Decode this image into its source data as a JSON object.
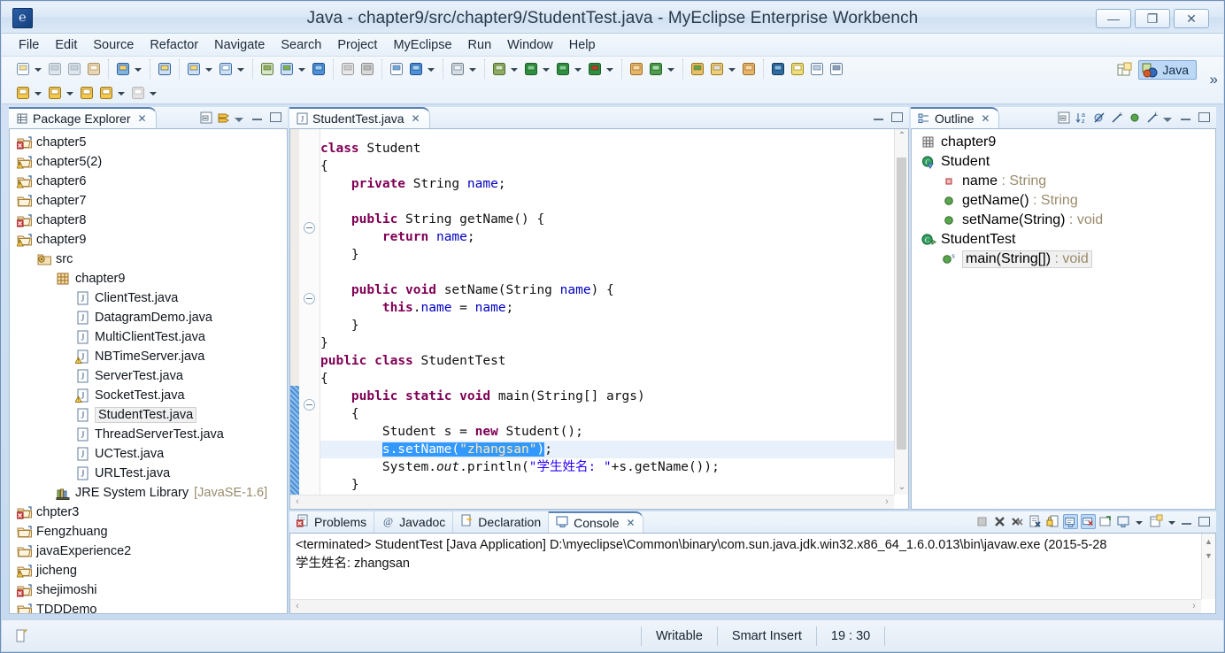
{
  "window": {
    "title": "Java - chapter9/src/chapter9/StudentTest.java - MyEclipse Enterprise Workbench",
    "app_icon": "eclipse-icon",
    "minimize_label": "—",
    "restore_label": "❐",
    "close_label": "✕"
  },
  "menubar": {
    "items": [
      "File",
      "Edit",
      "Source",
      "Refactor",
      "Navigate",
      "Search",
      "Project",
      "MyEclipse",
      "Run",
      "Window",
      "Help"
    ]
  },
  "toolbar": {
    "perspective_label": "Java",
    "overflow_label": "»",
    "groups_row1": [
      [
        "new-wizard-icon",
        "new-dropdown-arrow",
        "save-icon",
        "save-all-icon",
        "print-icon"
      ],
      [
        "myeclipse-icon",
        "myeclipse-dropdown-arrow"
      ],
      [
        "deploy-icon"
      ],
      [
        "new-java-project-icon",
        "new-java-dd-arrow",
        "new-class-icon",
        "new-class-dd-arrow"
      ],
      [
        "import-icon",
        "export-icon",
        "export-dd-arrow",
        "web-browser-icon"
      ],
      [
        "build-icon",
        "refresh-icon"
      ],
      [
        "report-icon",
        "web-preview-icon",
        "web-preview-dd-arrow"
      ],
      [
        "database-icon",
        "database-dd-arrow"
      ],
      [
        "debug-icon",
        "debug-dd-arrow",
        "run-icon",
        "run-dd-arrow",
        "run-config-icon",
        "run-config-dd-arrow",
        "coverage-icon",
        "coverage-dd-arrow"
      ],
      [
        "new-package-icon",
        "open-type-icon",
        "open-type-dd-arrow"
      ],
      [
        "open-folder-icon",
        "edit-icon",
        "edit-dd-arrow",
        "package-icon"
      ],
      [
        "search-icon",
        "highlight-icon",
        "outline-toggle-icon",
        "pilcrow-icon"
      ]
    ],
    "groups_row2": [
      [
        "previous-annotation-icon",
        "prev-annotation-dd-arrow",
        "next-annotation-icon",
        "next-annotation-dd-arrow",
        "back-icon",
        "forward-icon",
        "forward-dd-arrow",
        "next-edit-icon",
        "next-edit-dd-arrow"
      ]
    ]
  },
  "package_explorer": {
    "title": "Package Explorer",
    "close_label": "✕",
    "tools": [
      "collapse-all-icon",
      "link-with-editor-icon",
      "view-menu-icon",
      "minimize-icon",
      "maximize-icon"
    ],
    "tree": [
      {
        "label": "chapter5",
        "indent": 0,
        "icon": "project-closed-error-icon",
        "twisty": ""
      },
      {
        "label": "chapter5(2)",
        "indent": 0,
        "icon": "project-closed-warn-icon",
        "twisty": ""
      },
      {
        "label": "chapter6",
        "indent": 0,
        "icon": "project-closed-warn-icon",
        "twisty": ""
      },
      {
        "label": "chapter7",
        "indent": 0,
        "icon": "project-closed-icon",
        "twisty": ""
      },
      {
        "label": "chapter8",
        "indent": 0,
        "icon": "project-closed-error-icon",
        "twisty": ""
      },
      {
        "label": "chapter9",
        "indent": 0,
        "icon": "project-open-warn-icon",
        "twisty": ""
      },
      {
        "label": "src",
        "indent": 1,
        "icon": "source-folder-icon",
        "twisty": ""
      },
      {
        "label": "chapter9",
        "indent": 2,
        "icon": "package-icon",
        "twisty": ""
      },
      {
        "label": "ClientTest.java",
        "indent": 3,
        "icon": "java-file-icon",
        "twisty": ""
      },
      {
        "label": "DatagramDemo.java",
        "indent": 3,
        "icon": "java-file-icon",
        "twisty": ""
      },
      {
        "label": "MultiClientTest.java",
        "indent": 3,
        "icon": "java-file-icon",
        "twisty": ""
      },
      {
        "label": "NBTimeServer.java",
        "indent": 3,
        "icon": "java-file-warn-icon",
        "twisty": ""
      },
      {
        "label": "ServerTest.java",
        "indent": 3,
        "icon": "java-file-icon",
        "twisty": ""
      },
      {
        "label": "SocketTest.java",
        "indent": 3,
        "icon": "java-file-warn-icon",
        "twisty": ""
      },
      {
        "label": "StudentTest.java",
        "indent": 3,
        "icon": "java-file-icon",
        "selected": true,
        "twisty": ""
      },
      {
        "label": "ThreadServerTest.java",
        "indent": 3,
        "icon": "java-file-icon",
        "twisty": ""
      },
      {
        "label": "UCTest.java",
        "indent": 3,
        "icon": "java-file-icon",
        "twisty": ""
      },
      {
        "label": "URLTest.java",
        "indent": 3,
        "icon": "java-file-icon",
        "twisty": ""
      },
      {
        "label": "JRE System Library",
        "indent": 2,
        "icon": "library-icon",
        "suffix": "[JavaSE-1.6]",
        "twisty": ""
      },
      {
        "label": "chpter3",
        "indent": 0,
        "icon": "project-closed-error-icon",
        "twisty": ""
      },
      {
        "label": "Fengzhuang",
        "indent": 0,
        "icon": "project-closed-icon",
        "twisty": ""
      },
      {
        "label": "javaExperience2",
        "indent": 0,
        "icon": "project-closed-icon",
        "twisty": ""
      },
      {
        "label": "jicheng",
        "indent": 0,
        "icon": "project-closed-warn-icon",
        "twisty": ""
      },
      {
        "label": "shejimoshi",
        "indent": 0,
        "icon": "project-closed-error-icon",
        "twisty": ""
      },
      {
        "label": "TDDDemo",
        "indent": 0,
        "icon": "project-closed-icon",
        "twisty": ""
      }
    ]
  },
  "editor": {
    "tab_label": "StudentTest.java",
    "tab_icon": "java-file-icon",
    "close_label": "✕",
    "tools": [
      "minimize-icon",
      "maximize-icon"
    ],
    "code_lines": [
      {
        "t": "partial",
        "text": ""
      },
      {
        "t": "code",
        "text": "class Student",
        "kw": [
          "class"
        ]
      },
      {
        "t": "code",
        "text": "{"
      },
      {
        "t": "code",
        "text": "    private String name;"
      },
      {
        "t": "blank",
        "text": ""
      },
      {
        "t": "code",
        "text": "    public String getName() {",
        "fold": true
      },
      {
        "t": "code",
        "text": "        return name;"
      },
      {
        "t": "code",
        "text": "    }"
      },
      {
        "t": "blank",
        "text": ""
      },
      {
        "t": "code",
        "text": "    public void setName(String name) {",
        "fold": true
      },
      {
        "t": "code",
        "text": "        this.name = name;"
      },
      {
        "t": "code",
        "text": "    }"
      },
      {
        "t": "code",
        "text": "}"
      },
      {
        "t": "code",
        "text": "public class StudentTest"
      },
      {
        "t": "code",
        "text": "{"
      },
      {
        "t": "code",
        "text": "    public static void main(String[] args)",
        "fold": true
      },
      {
        "t": "code",
        "text": "    {"
      },
      {
        "t": "code",
        "text": "        Student s = new Student();"
      },
      {
        "t": "code",
        "text": "        s.setName(\"zhangsan\");",
        "selected": true
      },
      {
        "t": "code",
        "text": "        System.out.println(\"学生姓名: \"+s.getName());"
      },
      {
        "t": "code",
        "text": "    }"
      }
    ],
    "scroll_up": "⌃",
    "scroll_down": "⌄",
    "hscroll_left": "‹",
    "hscroll_right": "›"
  },
  "outline": {
    "title": "Outline",
    "close_label": "✕",
    "tools": [
      "collapse-all-icon",
      "sort-icon",
      "hide-fields-icon",
      "hide-static-icon",
      "hide-nonpublic-icon",
      "hide-local-icon",
      "view-menu-icon",
      "minimize-icon",
      "maximize-icon"
    ],
    "items": [
      {
        "label": "chapter9",
        "type": "",
        "indent": 0,
        "icon": "package-icon"
      },
      {
        "label": "Student",
        "type": "",
        "indent": 0,
        "icon": "class-default-icon"
      },
      {
        "label": "name",
        "type": ": String",
        "indent": 1,
        "icon": "field-private-icon"
      },
      {
        "label": "getName()",
        "type": ": String",
        "indent": 1,
        "icon": "method-public-icon"
      },
      {
        "label": "setName(String)",
        "type": ": void",
        "indent": 1,
        "icon": "method-public-icon"
      },
      {
        "label": "StudentTest",
        "type": "",
        "indent": 0,
        "icon": "class-public-icon"
      },
      {
        "label": "main(String[])",
        "type": ": void",
        "indent": 1,
        "icon": "method-public-static-icon",
        "selected": true
      }
    ]
  },
  "bottom_panel": {
    "tabs": [
      {
        "label": "Problems",
        "icon": "problems-icon",
        "active": false
      },
      {
        "label": "Javadoc",
        "icon": "javadoc-icon",
        "active": false
      },
      {
        "label": "Declaration",
        "icon": "declaration-icon",
        "active": false
      },
      {
        "label": "Console",
        "icon": "console-icon",
        "active": true,
        "close_label": "✕"
      }
    ],
    "tools": [
      "terminate-icon",
      "remove-launch-icon",
      "remove-all-launches-icon",
      "clear-console-icon",
      "scroll-lock-icon",
      "show-console-on-output-icon",
      "show-console-on-error-icon",
      "open-console-icon",
      "display-selected-console-icon",
      "display-dd-arrow",
      "new-console-view-icon",
      "new-console-dd-arrow",
      "minimize-icon",
      "maximize-icon"
    ],
    "console_header": "<terminated> StudentTest [Java Application] D:\\myeclipse\\Common\\binary\\com.sun.java.jdk.win32.x86_64_1.6.0.013\\bin\\javaw.exe (2015-5-28",
    "console_output": "学生姓名: zhangsan",
    "hscroll_left": "‹",
    "hscroll_right": "›"
  },
  "statusbar": {
    "icon": "editor-status-icon",
    "writable": "Writable",
    "insert_mode": "Smart Insert",
    "cursor_position": "19 : 30"
  },
  "colors": {
    "accent": "#5b84b5",
    "selection": "#3399ff",
    "keyword": "#7f0055",
    "string": "#2a00ff",
    "field": "#0000c0",
    "type_dim": "#9a8b6b"
  }
}
